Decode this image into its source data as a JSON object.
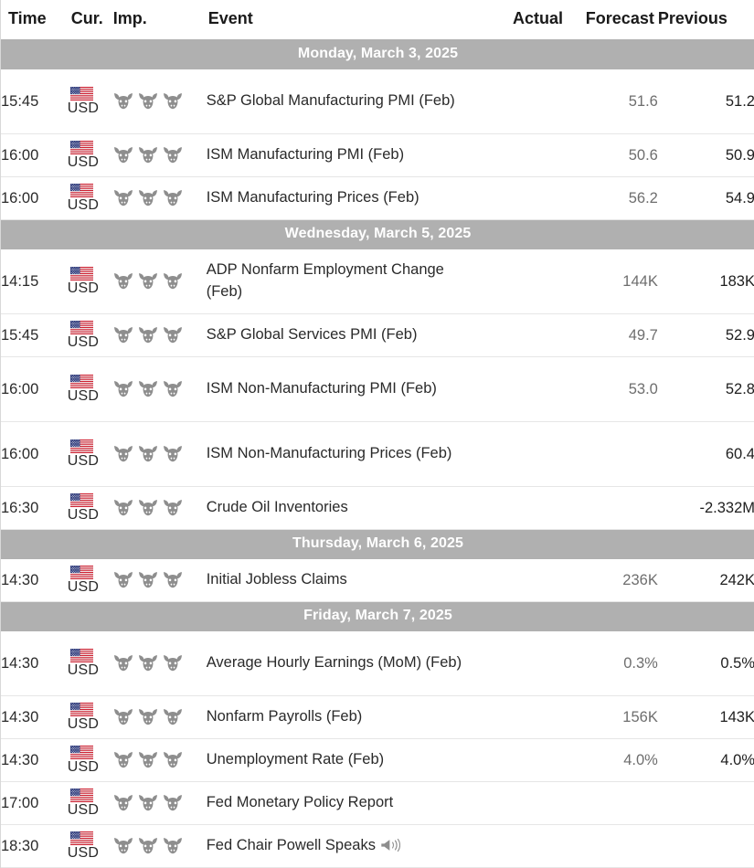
{
  "table": {
    "columns": {
      "time": "Time",
      "currency": "Cur.",
      "importance": "Imp.",
      "event": "Event",
      "actual": "Actual",
      "forecast": "Forecast",
      "previous": "Previous"
    },
    "colors": {
      "date_band_bg": "#b0b0b0",
      "date_band_text": "#ffffff",
      "row_border": "#e6e6e6",
      "forecast_text": "#6e6e6e",
      "previous_text": "#1e1e1e",
      "bull_icon": "#8a8a8a"
    },
    "groups": [
      {
        "date": "Monday, March 3, 2025",
        "rows": [
          {
            "time": "15:45",
            "currency": "USD",
            "flag": "us-flag-icon",
            "importance": 3,
            "event": "S&P Global Manufacturing PMI (Feb)",
            "actual": "",
            "forecast": "51.6",
            "previous": "51.2",
            "tall": true,
            "speaker": false
          },
          {
            "time": "16:00",
            "currency": "USD",
            "flag": "us-flag-icon",
            "importance": 3,
            "event": "ISM Manufacturing PMI (Feb)",
            "actual": "",
            "forecast": "50.6",
            "previous": "50.9",
            "tall": false,
            "speaker": false
          },
          {
            "time": "16:00",
            "currency": "USD",
            "flag": "us-flag-icon",
            "importance": 3,
            "event": "ISM Manufacturing Prices (Feb)",
            "actual": "",
            "forecast": "56.2",
            "previous": "54.9",
            "tall": false,
            "speaker": false
          }
        ]
      },
      {
        "date": "Wednesday, March 5, 2025",
        "rows": [
          {
            "time": "14:15",
            "currency": "USD",
            "flag": "us-flag-icon",
            "importance": 3,
            "event": "ADP Nonfarm Employment Change (Feb)",
            "actual": "",
            "forecast": "144K",
            "previous": "183K",
            "tall": true,
            "speaker": false
          },
          {
            "time": "15:45",
            "currency": "USD",
            "flag": "us-flag-icon",
            "importance": 3,
            "event": "S&P Global Services PMI (Feb)",
            "actual": "",
            "forecast": "49.7",
            "previous": "52.9",
            "tall": false,
            "speaker": false
          },
          {
            "time": "16:00",
            "currency": "USD",
            "flag": "us-flag-icon",
            "importance": 3,
            "event": "ISM Non-Manufacturing PMI (Feb)",
            "actual": "",
            "forecast": "53.0",
            "previous": "52.8",
            "tall": true,
            "speaker": false
          },
          {
            "time": "16:00",
            "currency": "USD",
            "flag": "us-flag-icon",
            "importance": 3,
            "event": "ISM Non-Manufacturing Prices (Feb)",
            "actual": "",
            "forecast": "",
            "previous": "60.4",
            "tall": true,
            "speaker": false
          },
          {
            "time": "16:30",
            "currency": "USD",
            "flag": "us-flag-icon",
            "importance": 3,
            "event": "Crude Oil Inventories",
            "actual": "",
            "forecast": "",
            "previous": "-2.332M",
            "tall": false,
            "speaker": false
          }
        ]
      },
      {
        "date": "Thursday, March 6, 2025",
        "rows": [
          {
            "time": "14:30",
            "currency": "USD",
            "flag": "us-flag-icon",
            "importance": 3,
            "event": "Initial Jobless Claims",
            "actual": "",
            "forecast": "236K",
            "previous": "242K",
            "tall": false,
            "speaker": false
          }
        ]
      },
      {
        "date": "Friday, March 7, 2025",
        "rows": [
          {
            "time": "14:30",
            "currency": "USD",
            "flag": "us-flag-icon",
            "importance": 3,
            "event": "Average Hourly Earnings (MoM) (Feb)",
            "actual": "",
            "forecast": "0.3%",
            "previous": "0.5%",
            "tall": true,
            "speaker": false
          },
          {
            "time": "14:30",
            "currency": "USD",
            "flag": "us-flag-icon",
            "importance": 3,
            "event": "Nonfarm Payrolls (Feb)",
            "actual": "",
            "forecast": "156K",
            "previous": "143K",
            "tall": false,
            "speaker": false
          },
          {
            "time": "14:30",
            "currency": "USD",
            "flag": "us-flag-icon",
            "importance": 3,
            "event": "Unemployment Rate (Feb)",
            "actual": "",
            "forecast": "4.0%",
            "previous": "4.0%",
            "tall": false,
            "speaker": false
          },
          {
            "time": "17:00",
            "currency": "USD",
            "flag": "us-flag-icon",
            "importance": 3,
            "event": "Fed Monetary Policy Report",
            "actual": "",
            "forecast": "",
            "previous": "",
            "tall": false,
            "speaker": false
          },
          {
            "time": "18:30",
            "currency": "USD",
            "flag": "us-flag-icon",
            "importance": 3,
            "event": "Fed Chair Powell Speaks",
            "actual": "",
            "forecast": "",
            "previous": "",
            "tall": false,
            "speaker": true
          }
        ]
      }
    ]
  }
}
